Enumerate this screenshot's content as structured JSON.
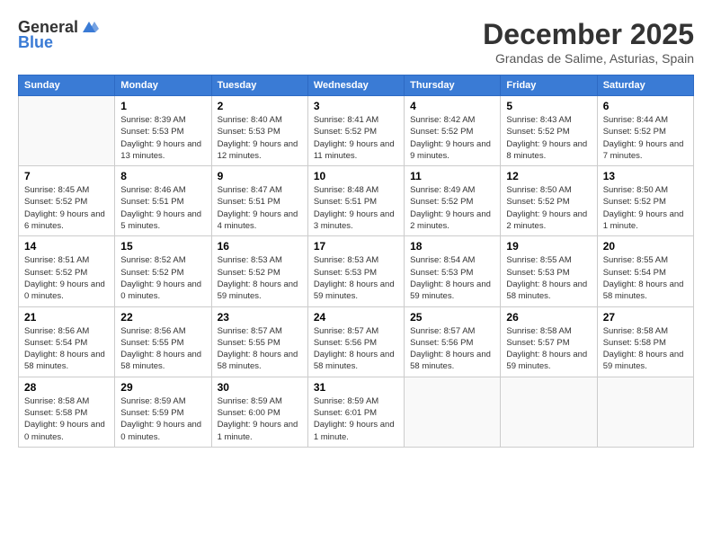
{
  "header": {
    "logo_general": "General",
    "logo_blue": "Blue",
    "month": "December 2025",
    "location": "Grandas de Salime, Asturias, Spain"
  },
  "days_of_week": [
    "Sunday",
    "Monday",
    "Tuesday",
    "Wednesday",
    "Thursday",
    "Friday",
    "Saturday"
  ],
  "weeks": [
    [
      {
        "day": "",
        "sunrise": "",
        "sunset": "",
        "daylight": ""
      },
      {
        "day": "1",
        "sunrise": "8:39 AM",
        "sunset": "5:53 PM",
        "daylight": "9 hours and 13 minutes."
      },
      {
        "day": "2",
        "sunrise": "8:40 AM",
        "sunset": "5:53 PM",
        "daylight": "9 hours and 12 minutes."
      },
      {
        "day": "3",
        "sunrise": "8:41 AM",
        "sunset": "5:52 PM",
        "daylight": "9 hours and 11 minutes."
      },
      {
        "day": "4",
        "sunrise": "8:42 AM",
        "sunset": "5:52 PM",
        "daylight": "9 hours and 9 minutes."
      },
      {
        "day": "5",
        "sunrise": "8:43 AM",
        "sunset": "5:52 PM",
        "daylight": "9 hours and 8 minutes."
      },
      {
        "day": "6",
        "sunrise": "8:44 AM",
        "sunset": "5:52 PM",
        "daylight": "9 hours and 7 minutes."
      }
    ],
    [
      {
        "day": "7",
        "sunrise": "8:45 AM",
        "sunset": "5:52 PM",
        "daylight": "9 hours and 6 minutes."
      },
      {
        "day": "8",
        "sunrise": "8:46 AM",
        "sunset": "5:51 PM",
        "daylight": "9 hours and 5 minutes."
      },
      {
        "day": "9",
        "sunrise": "8:47 AM",
        "sunset": "5:51 PM",
        "daylight": "9 hours and 4 minutes."
      },
      {
        "day": "10",
        "sunrise": "8:48 AM",
        "sunset": "5:51 PM",
        "daylight": "9 hours and 3 minutes."
      },
      {
        "day": "11",
        "sunrise": "8:49 AM",
        "sunset": "5:52 PM",
        "daylight": "9 hours and 2 minutes."
      },
      {
        "day": "12",
        "sunrise": "8:50 AM",
        "sunset": "5:52 PM",
        "daylight": "9 hours and 2 minutes."
      },
      {
        "day": "13",
        "sunrise": "8:50 AM",
        "sunset": "5:52 PM",
        "daylight": "9 hours and 1 minute."
      }
    ],
    [
      {
        "day": "14",
        "sunrise": "8:51 AM",
        "sunset": "5:52 PM",
        "daylight": "9 hours and 0 minutes."
      },
      {
        "day": "15",
        "sunrise": "8:52 AM",
        "sunset": "5:52 PM",
        "daylight": "9 hours and 0 minutes."
      },
      {
        "day": "16",
        "sunrise": "8:53 AM",
        "sunset": "5:52 PM",
        "daylight": "8 hours and 59 minutes."
      },
      {
        "day": "17",
        "sunrise": "8:53 AM",
        "sunset": "5:53 PM",
        "daylight": "8 hours and 59 minutes."
      },
      {
        "day": "18",
        "sunrise": "8:54 AM",
        "sunset": "5:53 PM",
        "daylight": "8 hours and 59 minutes."
      },
      {
        "day": "19",
        "sunrise": "8:55 AM",
        "sunset": "5:53 PM",
        "daylight": "8 hours and 58 minutes."
      },
      {
        "day": "20",
        "sunrise": "8:55 AM",
        "sunset": "5:54 PM",
        "daylight": "8 hours and 58 minutes."
      }
    ],
    [
      {
        "day": "21",
        "sunrise": "8:56 AM",
        "sunset": "5:54 PM",
        "daylight": "8 hours and 58 minutes."
      },
      {
        "day": "22",
        "sunrise": "8:56 AM",
        "sunset": "5:55 PM",
        "daylight": "8 hours and 58 minutes."
      },
      {
        "day": "23",
        "sunrise": "8:57 AM",
        "sunset": "5:55 PM",
        "daylight": "8 hours and 58 minutes."
      },
      {
        "day": "24",
        "sunrise": "8:57 AM",
        "sunset": "5:56 PM",
        "daylight": "8 hours and 58 minutes."
      },
      {
        "day": "25",
        "sunrise": "8:57 AM",
        "sunset": "5:56 PM",
        "daylight": "8 hours and 58 minutes."
      },
      {
        "day": "26",
        "sunrise": "8:58 AM",
        "sunset": "5:57 PM",
        "daylight": "8 hours and 59 minutes."
      },
      {
        "day": "27",
        "sunrise": "8:58 AM",
        "sunset": "5:58 PM",
        "daylight": "8 hours and 59 minutes."
      }
    ],
    [
      {
        "day": "28",
        "sunrise": "8:58 AM",
        "sunset": "5:58 PM",
        "daylight": "9 hours and 0 minutes."
      },
      {
        "day": "29",
        "sunrise": "8:59 AM",
        "sunset": "5:59 PM",
        "daylight": "9 hours and 0 minutes."
      },
      {
        "day": "30",
        "sunrise": "8:59 AM",
        "sunset": "6:00 PM",
        "daylight": "9 hours and 1 minute."
      },
      {
        "day": "31",
        "sunrise": "8:59 AM",
        "sunset": "6:01 PM",
        "daylight": "9 hours and 1 minute."
      },
      {
        "day": "",
        "sunrise": "",
        "sunset": "",
        "daylight": ""
      },
      {
        "day": "",
        "sunrise": "",
        "sunset": "",
        "daylight": ""
      },
      {
        "day": "",
        "sunrise": "",
        "sunset": "",
        "daylight": ""
      }
    ]
  ]
}
